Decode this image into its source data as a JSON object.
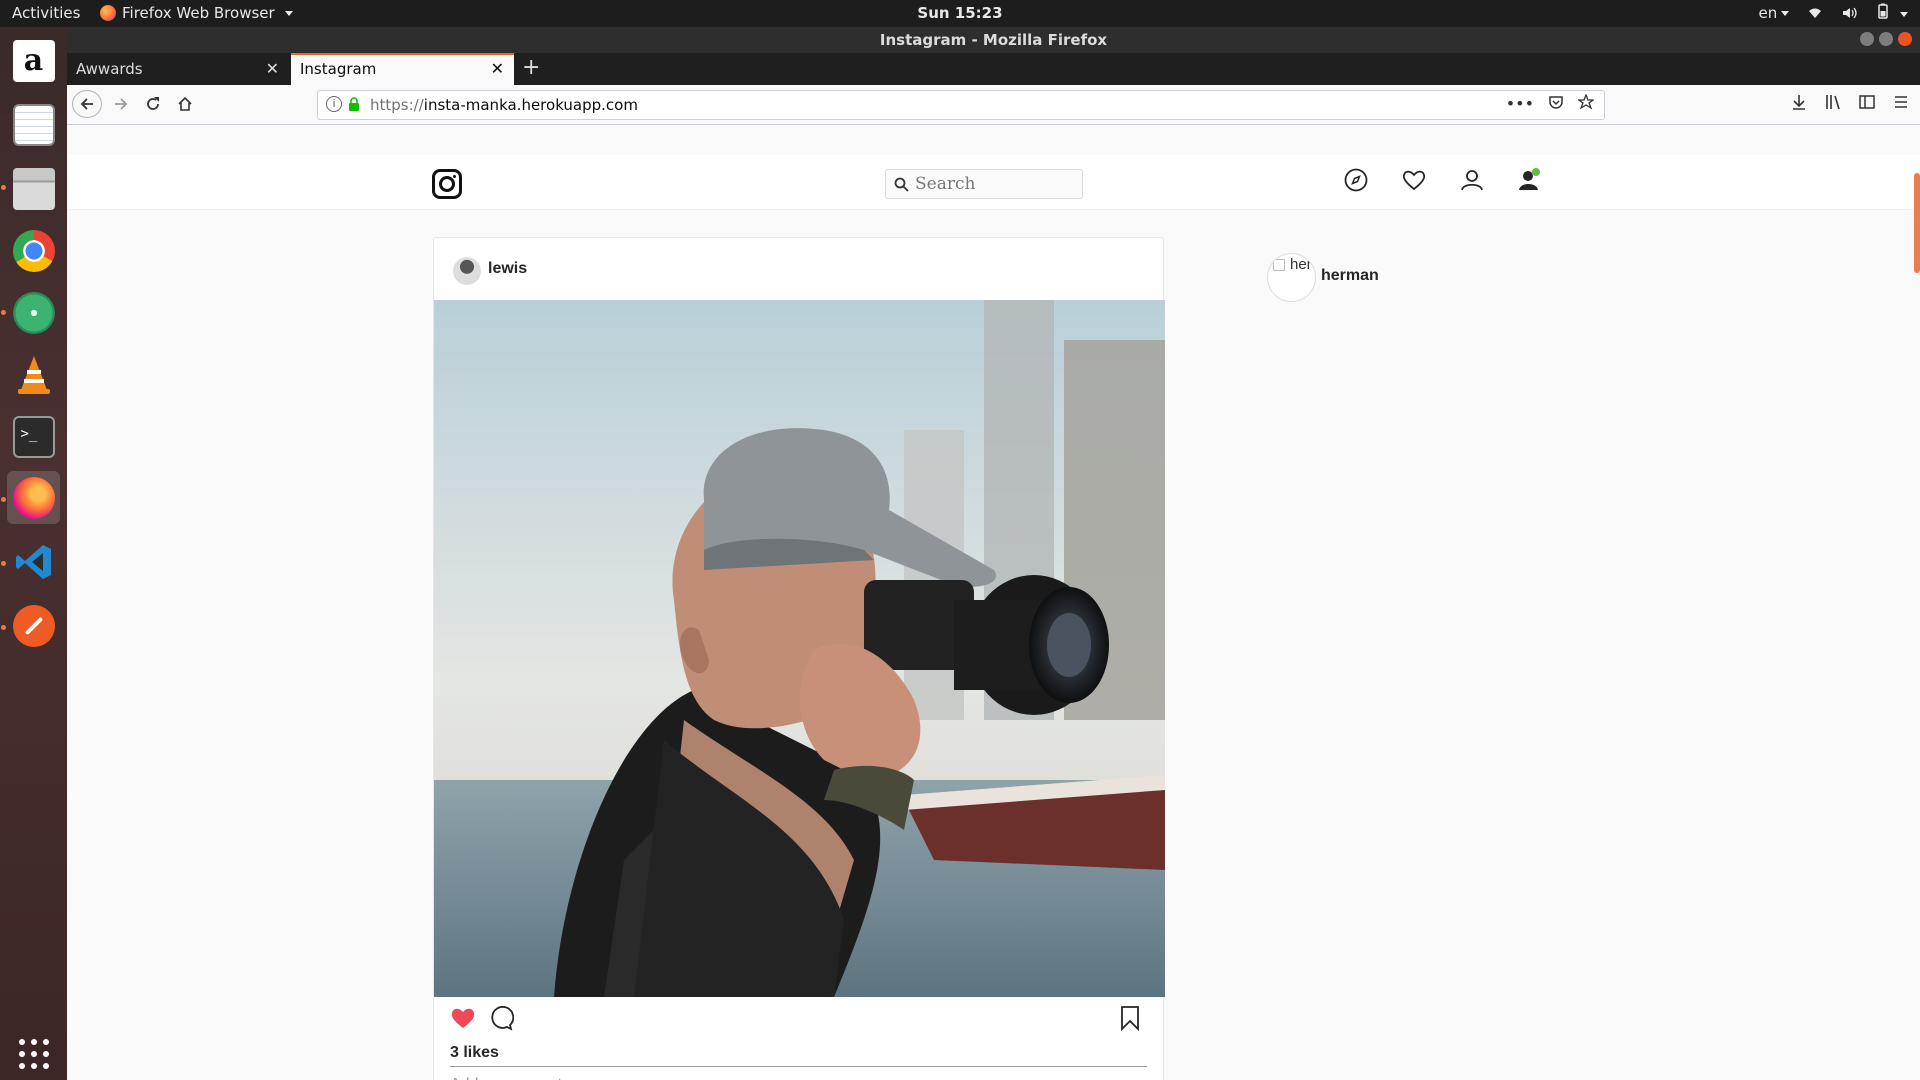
{
  "topbar": {
    "activities": "Activities",
    "app_menu": "Firefox Web Browser",
    "clock": "Sun 15:23",
    "language": "en"
  },
  "dock": {
    "items": [
      "amazon-icon",
      "text-editor-icon",
      "files-icon",
      "chrome-icon",
      "atom-icon",
      "vlc-icon",
      "terminal-icon",
      "firefox-icon",
      "vscode-icon",
      "postman-icon",
      "app-grid-icon"
    ],
    "accent": "#f07746"
  },
  "window": {
    "title": "Instagram - Mozilla Firefox",
    "tabs": [
      {
        "label": "Awwards",
        "selected": false
      },
      {
        "label": "Instagram",
        "selected": true
      }
    ],
    "url_protocol": "https://",
    "url_host": "insta-manka.herokuapp.com"
  },
  "instagram": {
    "search_placeholder": "Search",
    "post": {
      "username": "lewis",
      "likes": "3 likes",
      "liked": true,
      "comment_placeholder": "Add a comment..."
    },
    "suggestion": {
      "avatar_alt": "her",
      "username": "herman"
    },
    "colors": {
      "heart": "#ed4956",
      "tab_accent": "#e66a2c"
    }
  }
}
